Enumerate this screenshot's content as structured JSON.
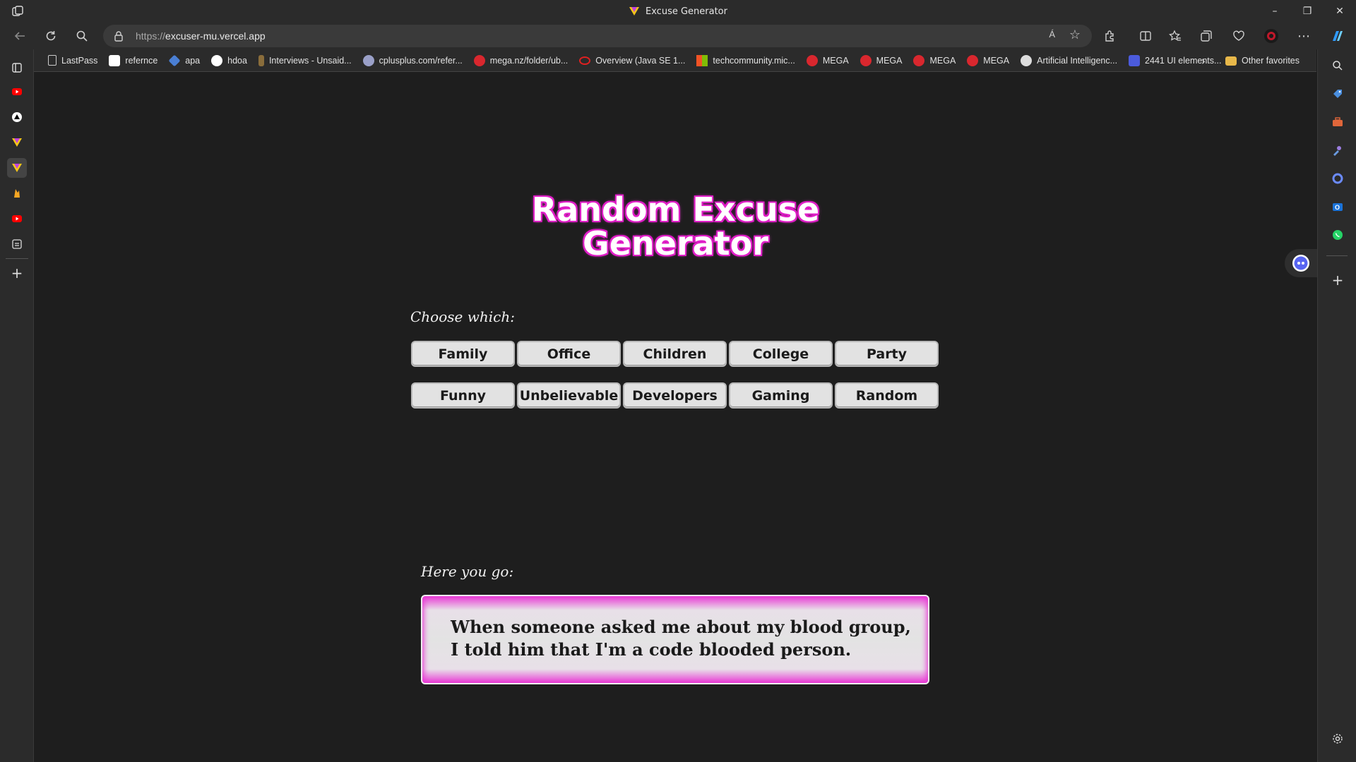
{
  "window": {
    "title": "Excuse Generator",
    "controls": [
      "–",
      "❐",
      "✕"
    ]
  },
  "address_bar": {
    "protocol": "https://",
    "host": "excuser-mu.vercel.app",
    "read_aloud": "Á"
  },
  "bookmarks": {
    "items": [
      {
        "label": "LastPass",
        "icon": "page-icon",
        "color": "#2b2b2b"
      },
      {
        "label": "refernce",
        "icon": "amazon-icon",
        "color": "#ffffff"
      },
      {
        "label": "apa",
        "icon": "apa-icon",
        "color": "#4a7fd4"
      },
      {
        "label": "hdoa",
        "icon": "google-icon",
        "color": "#ffffff"
      },
      {
        "label": "Interviews - Unsaid...",
        "icon": "interviews-icon",
        "color": "#8a6d3b"
      },
      {
        "label": "cplusplus.com/refer...",
        "icon": "cplusplus-icon",
        "color": "#9aa0c8"
      },
      {
        "label": "mega.nz/folder/ub...",
        "icon": "mega-icon",
        "color": "#d9272e"
      },
      {
        "label": "Overview (Java SE 1...",
        "icon": "oracle-icon",
        "color": "#e02020"
      },
      {
        "label": "techcommunity.mic...",
        "icon": "microsoft-icon",
        "color": "#f35325"
      },
      {
        "label": "MEGA",
        "icon": "mega-icon",
        "color": "#d9272e"
      },
      {
        "label": "MEGA",
        "icon": "mega-icon",
        "color": "#d9272e"
      },
      {
        "label": "MEGA",
        "icon": "mega-icon",
        "color": "#d9272e"
      },
      {
        "label": "MEGA",
        "icon": "mega-icon",
        "color": "#d9272e"
      },
      {
        "label": "Artificial Intelligenc...",
        "icon": "ai-icon",
        "color": "#dddddd"
      },
      {
        "label": "2441 UI elements...",
        "icon": "ui-icon",
        "color": "#4b5bdc"
      }
    ],
    "other": "Other favorites"
  },
  "page": {
    "heading_line1": "Random Excuse",
    "heading_line2": "Generator",
    "choose_label": "Choose which:",
    "categories_row1": [
      "Family",
      "Office",
      "Children",
      "College",
      "Party"
    ],
    "categories_row2": [
      "Funny",
      "Unbelievable",
      "Developers",
      "Gaming",
      "Random"
    ],
    "result_label": "Here you go:",
    "excuse": "When someone asked me about my blood group, I told him that I'm a code blooded person."
  },
  "colors": {
    "accent_pink": "#e020c8",
    "page_bg": "#1e1e1e",
    "chrome_bg": "#2b2b2b"
  }
}
